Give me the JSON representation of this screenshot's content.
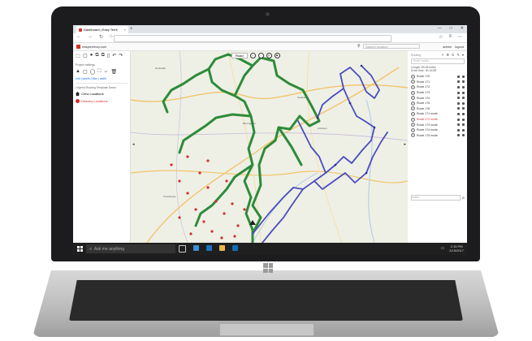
{
  "browser": {
    "tab_title": "Dashboard | Easy Territ",
    "tab_close": "×",
    "new_tab": "+",
    "window_controls": [
      "—",
      "□",
      "✕"
    ],
    "nav": [
      "←",
      "→",
      "↻",
      "⌂"
    ],
    "toolbar_icons": [
      "☆",
      "≡",
      "⋯"
    ]
  },
  "app": {
    "logo_text": "easyterritory.com",
    "search_placeholder": "Search location",
    "user_links": [
      "admin",
      "logout"
    ]
  },
  "left_panel": {
    "tools_row1": [
      "🗀",
      "▢",
      "●",
      "⧉",
      "⧉",
      "▯",
      "↶",
      "↷"
    ],
    "text_lines": [
      "Project settings"
    ],
    "tools_row2": [
      "▲",
      "▢",
      "◯",
      "⛶",
      "↔",
      "🗑"
    ],
    "links": "edit | labels | filter | width",
    "legend_title": "Legend   Routing Template Demo",
    "layers": [
      {
        "label": "Crew Locations",
        "symbol": "house"
      },
      {
        "label": "Delivery Locations",
        "symbol": "dot"
      }
    ]
  },
  "map": {
    "basemap_select": "Road",
    "left_arrow": "◂",
    "right_arrow": "▸",
    "places": [
      "Birmingham",
      "Anniston",
      "Gadsden",
      "Huntsville",
      "Tuscaloosa"
    ]
  },
  "right_panel": {
    "title": "Routing",
    "icons": "≡ ⚙ ↻ ✎ ▾",
    "filter_placeholder": "Enter routes",
    "summary_line1": "Length: 59.28 miles",
    "summary_line2": "Drive time: 3h 16:55",
    "routes": [
      {
        "label": "Route 170",
        "red": false
      },
      {
        "label": "Route 171",
        "red": false
      },
      {
        "label": "Route 172",
        "red": false
      },
      {
        "label": "Route 173",
        "red": false
      },
      {
        "label": "Route 174",
        "red": false
      },
      {
        "label": "Route 175",
        "red": false
      },
      {
        "label": "Route 176",
        "red": false
      },
      {
        "label": "Route 171 mode",
        "red": false
      },
      {
        "label": "Route 172 mode",
        "red": true
      },
      {
        "label": "Route 173 mode",
        "red": false
      },
      {
        "label": "Route 174 mode",
        "red": false
      },
      {
        "label": "Route 175 mode",
        "red": false
      }
    ],
    "footer_label": "select"
  },
  "taskbar": {
    "search_placeholder": "Ask me anything",
    "clock_time": "2:15 PM",
    "clock_date": "2/15/2017"
  }
}
